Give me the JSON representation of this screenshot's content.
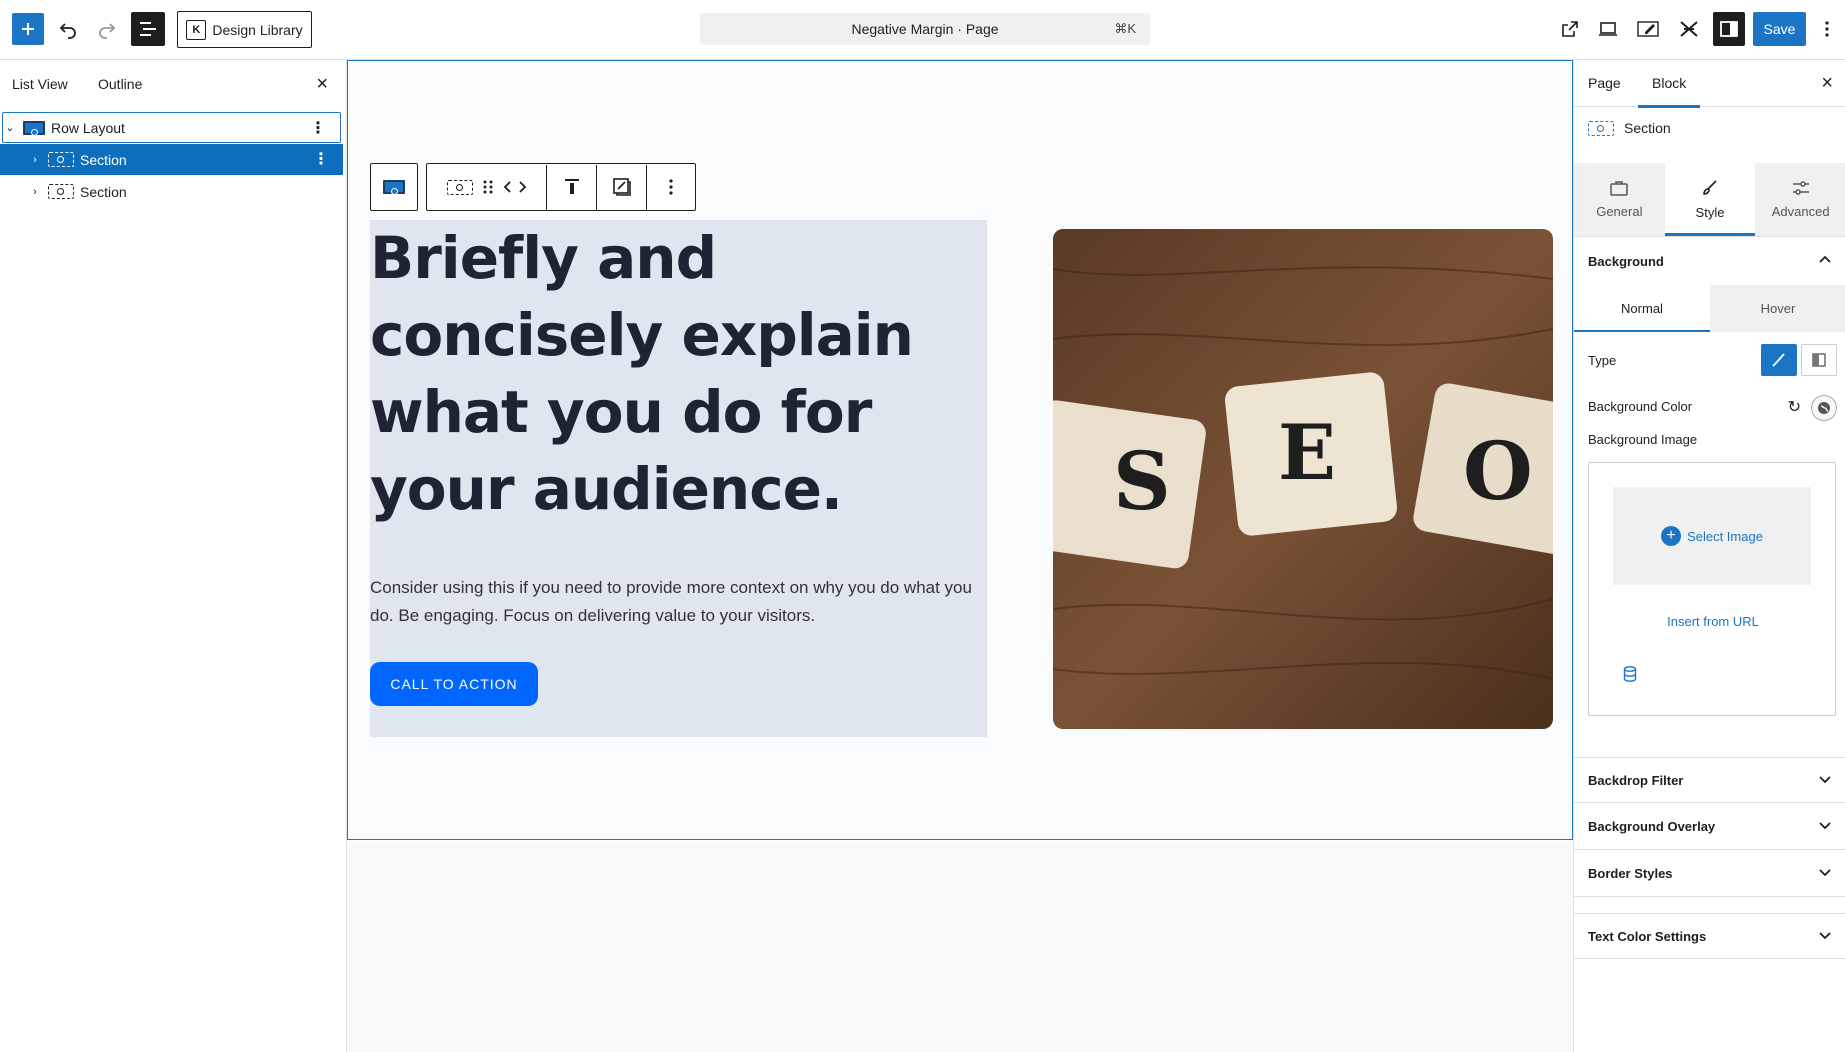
{
  "topbar": {
    "design_library_label": "Design Library",
    "document_title": "Negative Margin · Page",
    "shortcut": "⌘K",
    "save_label": "Save"
  },
  "left_panel": {
    "tabs": [
      "List View",
      "Outline"
    ],
    "tree": [
      {
        "label": "Row Layout"
      },
      {
        "label": "Section"
      },
      {
        "label": "Section"
      }
    ]
  },
  "canvas": {
    "headline": "Briefly and concisely explain what you do for your audience.",
    "description": "Consider using this if you need to provide more context on why you do what you do. Be engaging. Focus on delivering value to your visitors.",
    "cta_label": "CALL TO ACTION",
    "image_tiles": [
      "S",
      "E",
      "O"
    ]
  },
  "right_panel": {
    "tabs": [
      "Page",
      "Block"
    ],
    "block_name": "Section",
    "sub_tabs": [
      "General",
      "Style",
      "Advanced"
    ],
    "background": {
      "title": "Background",
      "states": [
        "Normal",
        "Hover"
      ],
      "type_label": "Type",
      "color_label": "Background Color",
      "image_label": "Background Image",
      "select_image": "Select Image",
      "insert_url": "Insert from URL"
    },
    "sections": [
      "Backdrop Filter",
      "Background Overlay",
      "Border Styles",
      "Text Color Settings"
    ]
  },
  "colors": {
    "accent": "#1c75c4",
    "cta": "#0066ff",
    "section_bg": "#dfe6f0"
  }
}
